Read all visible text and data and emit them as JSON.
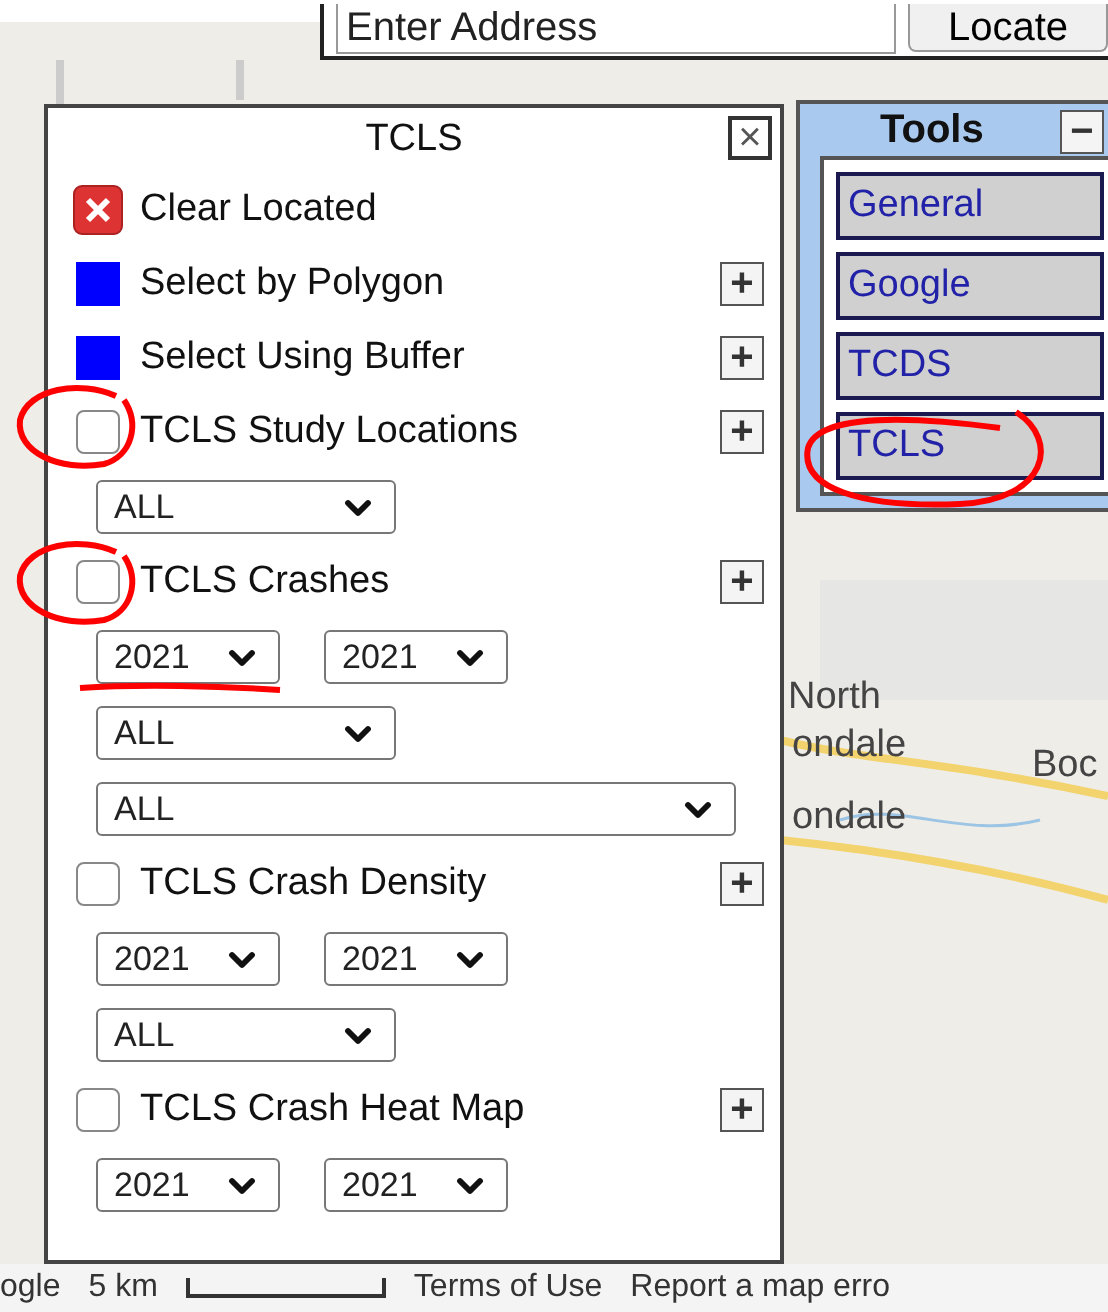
{
  "address_bar": {
    "placeholder": "Enter Address",
    "button": "Locate"
  },
  "map_labels": [
    "North",
    "ondale",
    "Boc",
    "ondale"
  ],
  "tcls_panel": {
    "title": "TCLS",
    "close": "×",
    "items": [
      {
        "kind": "clear",
        "label": "Clear Located"
      },
      {
        "kind": "tool",
        "label": "Select by Polygon",
        "expand": "+"
      },
      {
        "kind": "tool",
        "label": "Select Using Buffer",
        "expand": "+"
      },
      {
        "kind": "layer",
        "label": "TCLS Study Locations",
        "checked": false,
        "expand": "+",
        "rows": [
          [
            {
              "kind": "filter",
              "value": "ALL"
            }
          ]
        ]
      },
      {
        "kind": "layer",
        "label": "TCLS Crashes",
        "checked": false,
        "expand": "+",
        "rows": [
          [
            {
              "kind": "year",
              "value": "2021"
            },
            {
              "kind": "year",
              "value": "2021"
            }
          ],
          [
            {
              "kind": "filter",
              "value": "ALL"
            }
          ],
          [
            {
              "kind": "wide",
              "value": "ALL"
            }
          ]
        ]
      },
      {
        "kind": "layer",
        "label": "TCLS Crash Density",
        "checked": false,
        "expand": "+",
        "rows": [
          [
            {
              "kind": "year",
              "value": "2021"
            },
            {
              "kind": "year",
              "value": "2021"
            }
          ],
          [
            {
              "kind": "filter",
              "value": "ALL"
            }
          ]
        ]
      },
      {
        "kind": "layer",
        "label": "TCLS Crash Heat Map",
        "checked": false,
        "expand": "+",
        "rows": [
          [
            {
              "kind": "year",
              "value": "2021"
            },
            {
              "kind": "year",
              "value": "2021"
            }
          ]
        ]
      }
    ]
  },
  "tools_panel": {
    "title": "Tools",
    "collapse": "−",
    "buttons": [
      "General",
      "Google",
      "TCDS",
      "TCLS"
    ]
  },
  "footer": {
    "attribution": "ogle",
    "scale": "5 km",
    "terms": "Terms of Use",
    "report": "Report a map erro"
  }
}
